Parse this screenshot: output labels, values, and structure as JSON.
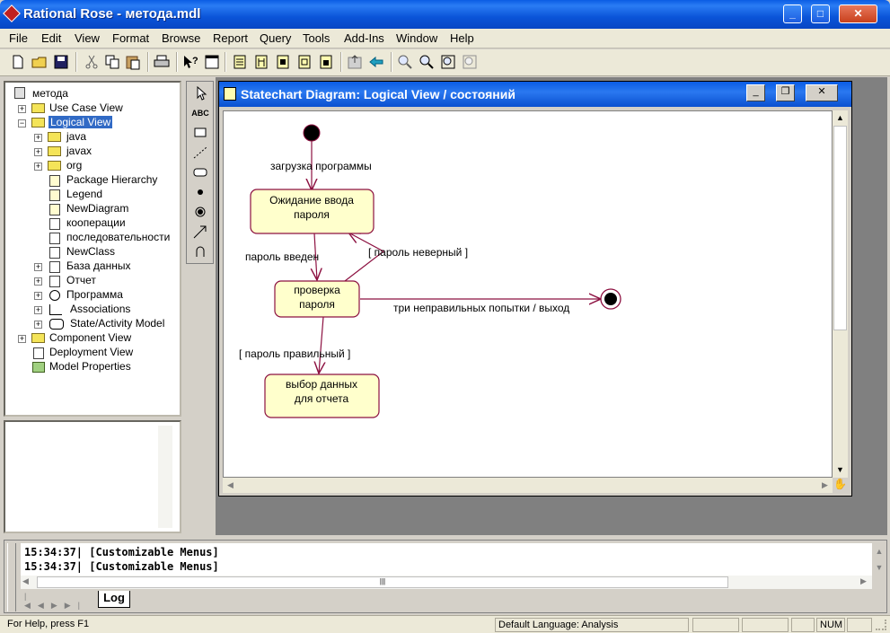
{
  "app": {
    "title": "Rational Rose - метода.mdl"
  },
  "menu": [
    "File",
    "Edit",
    "View",
    "Format",
    "Browse",
    "Report",
    "Query",
    "Tools",
    "Add-Ins",
    "Window",
    "Help"
  ],
  "tree": {
    "root": "метода",
    "items": [
      "Use Case View",
      "Logical View",
      "java",
      "javax",
      "org",
      "Package Hierarchy",
      "Legend",
      "NewDiagram",
      "кооперации",
      "последовательности",
      "NewClass",
      "База данных",
      "Отчет",
      "Программа",
      "Associations",
      "State/Activity Model",
      "Component View",
      "Deployment View",
      "Model Properties"
    ]
  },
  "palette": {
    "text_tool": "ABC"
  },
  "diagram": {
    "title": "Statechart Diagram: Logical View / состояний",
    "states": {
      "s1_l1": "Ожидание ввода",
      "s1_l2": "пароля",
      "s2_l1": "проверка",
      "s2_l2": "пароля",
      "s3_l1": "выбор данных",
      "s3_l2": "для отчета"
    },
    "transitions": {
      "t_start": "загрузка программы",
      "t_entered": "пароль введен",
      "t_wrong": "[ пароль неверный ]",
      "t_exit": "три неправильных попытки / выход",
      "t_right": "[ пароль правильный ]"
    }
  },
  "log": {
    "lines": [
      "15:34:37|  [Customizable Menus]",
      "15:34:37|  [Customizable Menus]"
    ],
    "tab": "Log"
  },
  "status": {
    "help": "For Help, press F1",
    "language": "Default Language: Analysis",
    "num": "NUM"
  }
}
